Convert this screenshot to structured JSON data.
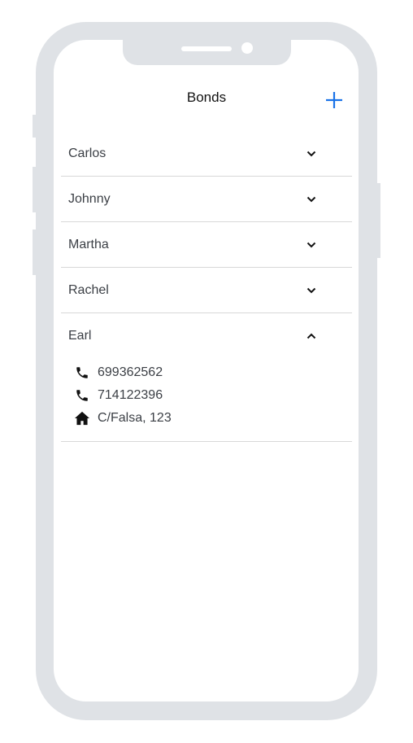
{
  "header": {
    "title": "Bonds",
    "add_icon": "plus-icon",
    "accent_color": "#1a73e8"
  },
  "contacts": [
    {
      "name": "Carlos",
      "expanded": false
    },
    {
      "name": "Johnny",
      "expanded": false
    },
    {
      "name": "Martha",
      "expanded": false
    },
    {
      "name": "Rachel",
      "expanded": false
    },
    {
      "name": "Earl",
      "expanded": true,
      "phones": [
        "699362562",
        "714122396"
      ],
      "address": "C/Falsa, 123"
    }
  ]
}
